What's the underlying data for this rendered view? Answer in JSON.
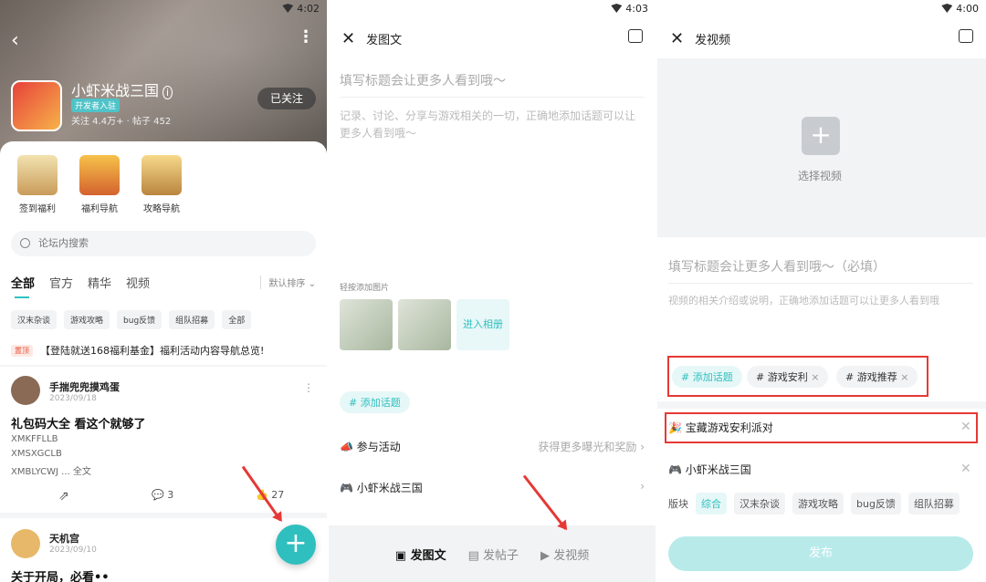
{
  "panel1": {
    "time": "4:02",
    "game": {
      "name": "小虾米战三国",
      "badge": "开发者入驻",
      "stats": "关注 4.4万+ · 帖子 452",
      "follow": "已关注"
    },
    "nav": [
      "签到福利",
      "福利导航",
      "攻略导航"
    ],
    "search_placeholder": "论坛内搜索",
    "tabs": [
      "全部",
      "官方",
      "精华",
      "视频"
    ],
    "sort": "默认排序",
    "chips": [
      "汉末杂谈",
      "游戏攻略",
      "bug反馈",
      "组队招募",
      "全部"
    ],
    "notice": {
      "tag": "置顶",
      "text": "【登陆就送168福利基金】福利活动内容导航总览!"
    },
    "posts": [
      {
        "user": "手揣兜兜摸鸡蛋",
        "date": "2023/09/18",
        "title": "礼包码大全 看这个就够了",
        "lines": [
          "XMKFFLLB",
          "XMSXGCLB",
          "XMBLYCWJ ... 全文"
        ],
        "comments": "3",
        "likes": "27"
      },
      {
        "user": "天机宫",
        "date": "2023/09/10",
        "title": "关于开局，必看••"
      }
    ]
  },
  "panel2": {
    "time": "4:03",
    "header": "发图文",
    "title_placeholder": "填写标题会让更多人看到哦〜",
    "desc_placeholder": "记录、讨论、分享与游戏相关的一切，正确地添加话题可以让更多人看到哦〜",
    "quick_label": "轻按添加图片",
    "album": "进入相册",
    "add_topic": "# 添加话题",
    "activity": {
      "label": "参与活动",
      "hint": "获得更多曝光和奖励"
    },
    "game": "小虾米战三国",
    "bottom": [
      "发图文",
      "发帖子",
      "发视频"
    ]
  },
  "panel3": {
    "time": "4:00",
    "header": "发视频",
    "select_video": "选择视频",
    "title_placeholder": "填写标题会让更多人看到哦〜（必填）",
    "desc_placeholder": "视频的相关介绍或说明，正确地添加话题可以让更多人看到哦",
    "topics": [
      "# 添加话题",
      "# 游戏安利",
      "# 游戏推荐"
    ],
    "activity": "宝藏游戏安利派对",
    "game": "小虾米战三国",
    "section_label": "版块",
    "sections": [
      "综合",
      "汉末杂谈",
      "游戏攻略",
      "bug反馈",
      "组队招募"
    ],
    "publish": "发布"
  },
  "colors": {
    "accent": "#2fbfbf",
    "annotation": "#e53935"
  }
}
